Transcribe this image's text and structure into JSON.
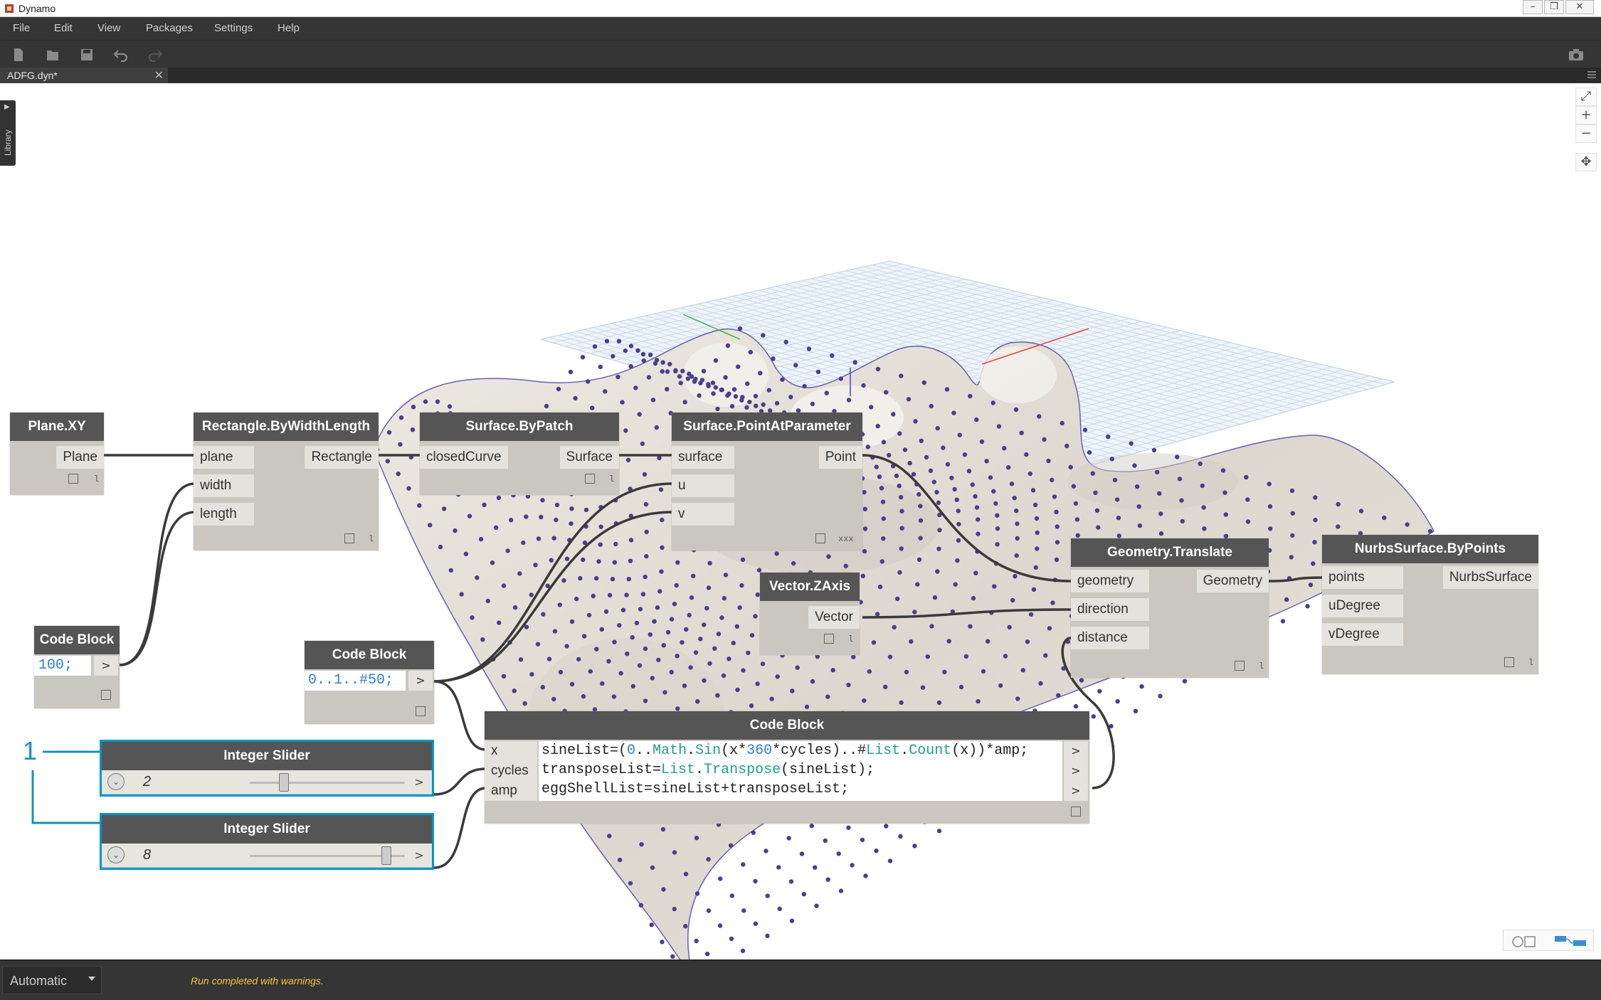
{
  "window": {
    "title": "Dynamo"
  },
  "menu": {
    "items": [
      "File",
      "Edit",
      "View",
      "Packages",
      "Settings",
      "Help"
    ]
  },
  "tab": {
    "label": "ADFG.dyn*"
  },
  "library": {
    "label": "Library"
  },
  "nodes": {
    "plane_xy": {
      "title": "Plane.XY",
      "outputs": [
        "Plane"
      ],
      "lacing": "l"
    },
    "rect": {
      "title": "Rectangle.ByWidthLength",
      "inputs": [
        "plane",
        "width",
        "length"
      ],
      "outputs": [
        "Rectangle"
      ],
      "lacing": "l"
    },
    "patch": {
      "title": "Surface.ByPatch",
      "inputs": [
        "closedCurve"
      ],
      "outputs": [
        "Surface"
      ],
      "lacing": "l"
    },
    "pap": {
      "title": "Surface.PointAtParameter",
      "inputs": [
        "surface",
        "u",
        "v"
      ],
      "outputs": [
        "Point"
      ],
      "lacing": "xxx"
    },
    "zaxis": {
      "title": "Vector.ZAxis",
      "outputs": [
        "Vector"
      ],
      "lacing": "l"
    },
    "translate": {
      "title": "Geometry.Translate",
      "inputs": [
        "geometry",
        "direction",
        "distance"
      ],
      "outputs": [
        "Geometry"
      ],
      "lacing": "l"
    },
    "nurbs": {
      "title": "NurbsSurface.ByPoints",
      "inputs": [
        "points",
        "uDegree",
        "vDegree"
      ],
      "outputs": [
        "NurbsSurface"
      ],
      "lacing": "l"
    },
    "cb_100": {
      "title": "Code Block",
      "code": "100;",
      "arrow": ">"
    },
    "cb_range": {
      "title": "Code Block",
      "code": "0..1..#50;",
      "arrow": ">"
    },
    "cb_main": {
      "title": "Code Block",
      "inputs": [
        "x",
        "cycles",
        "amp"
      ],
      "lines": [
        "sineList=(0..Math.Sin(x*360*cycles)..#List.Count(x))*amp;",
        "transposeList=List.Transpose(sineList);",
        "eggShellList=sineList+transposeList;"
      ],
      "arrow": ">"
    },
    "slider_1": {
      "title": "Integer Slider",
      "value": "2",
      "position": 0.22
    },
    "slider_2": {
      "title": "Integer Slider",
      "value": "8",
      "position": 0.88
    }
  },
  "callout": {
    "number": "1"
  },
  "status": {
    "run_mode": "Automatic",
    "message": "Run completed with warnings."
  },
  "colors": {
    "accent": "#0096c8",
    "warning": "#f6c43c",
    "point": "#4a3f8c",
    "surface": "#e9e6df"
  }
}
